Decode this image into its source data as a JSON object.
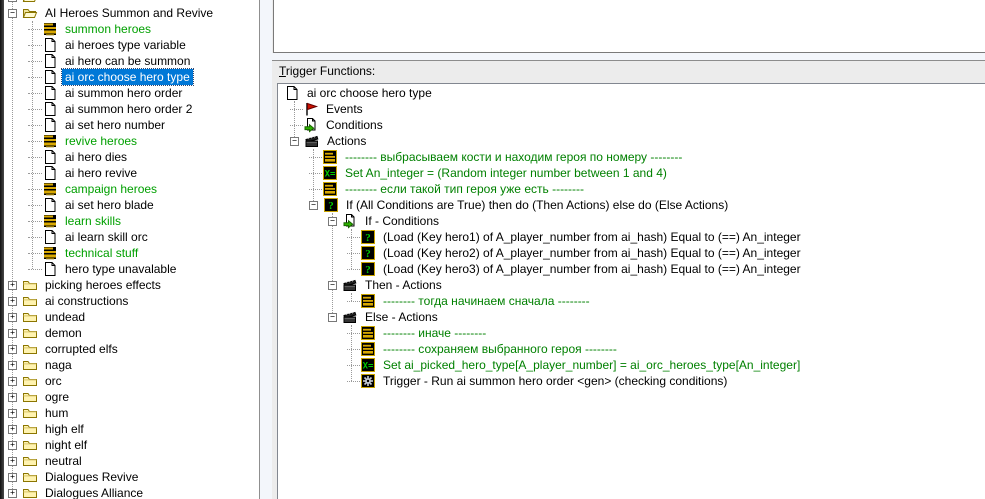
{
  "colors": {
    "selection": "#0078D7",
    "left_green": "#00A000",
    "right_green": "#008000",
    "comment_icon_gold": "#D8A800",
    "action_glyph_green": "#00CC00"
  },
  "left_tree": {
    "items": [
      {
        "label": "",
        "icon": "folder-open-icon",
        "level": 0,
        "expand": "minus",
        "partial": true
      },
      {
        "label": "AI Heroes Summon and Revive",
        "icon": "folder-open-icon",
        "level": 0,
        "expand": "minus"
      },
      {
        "label": "summon heroes",
        "icon": "comment-trigger-icon",
        "level": 1,
        "color": "green"
      },
      {
        "label": "ai heroes type variable",
        "icon": "page-icon",
        "level": 1
      },
      {
        "label": "ai hero can be summon",
        "icon": "page-icon",
        "level": 1
      },
      {
        "label": "ai orc choose hero type",
        "icon": "page-icon",
        "level": 1,
        "selected": true
      },
      {
        "label": "ai summon hero order",
        "icon": "page-icon",
        "level": 1
      },
      {
        "label": "ai summon hero order 2",
        "icon": "page-icon",
        "level": 1
      },
      {
        "label": "ai set hero number",
        "icon": "page-icon",
        "level": 1
      },
      {
        "label": "revive heroes",
        "icon": "comment-trigger-icon",
        "level": 1,
        "color": "green"
      },
      {
        "label": "ai hero dies",
        "icon": "page-icon",
        "level": 1
      },
      {
        "label": "ai hero revive",
        "icon": "page-icon",
        "level": 1
      },
      {
        "label": "campaign heroes",
        "icon": "comment-trigger-icon",
        "level": 1,
        "color": "green"
      },
      {
        "label": "ai set hero blade",
        "icon": "page-icon",
        "level": 1
      },
      {
        "label": "learn skills",
        "icon": "comment-trigger-icon",
        "level": 1,
        "color": "green"
      },
      {
        "label": "ai learn skill orc",
        "icon": "page-icon",
        "level": 1
      },
      {
        "label": "technical stuff",
        "icon": "comment-trigger-icon",
        "level": 1,
        "color": "green"
      },
      {
        "label": "hero type unavalable",
        "icon": "page-icon",
        "level": 1
      },
      {
        "label": "picking heroes effects",
        "icon": "folder-closed-icon",
        "level": 0,
        "expand": "plus"
      },
      {
        "label": "ai constructions",
        "icon": "folder-closed-icon",
        "level": 0,
        "expand": "plus"
      },
      {
        "label": "undead",
        "icon": "folder-closed-icon",
        "level": 0,
        "expand": "plus"
      },
      {
        "label": "demon",
        "icon": "folder-closed-icon",
        "level": 0,
        "expand": "plus"
      },
      {
        "label": "corrupted elfs",
        "icon": "folder-closed-icon",
        "level": 0,
        "expand": "plus"
      },
      {
        "label": "naga",
        "icon": "folder-closed-icon",
        "level": 0,
        "expand": "plus"
      },
      {
        "label": "orc",
        "icon": "folder-closed-icon",
        "level": 0,
        "expand": "plus"
      },
      {
        "label": "ogre",
        "icon": "folder-closed-icon",
        "level": 0,
        "expand": "plus"
      },
      {
        "label": "hum",
        "icon": "folder-closed-icon",
        "level": 0,
        "expand": "plus"
      },
      {
        "label": "high elf",
        "icon": "folder-closed-icon",
        "level": 0,
        "expand": "plus"
      },
      {
        "label": "night elf",
        "icon": "folder-closed-icon",
        "level": 0,
        "expand": "plus"
      },
      {
        "label": "neutral",
        "icon": "folder-closed-icon",
        "level": 0,
        "expand": "plus"
      },
      {
        "label": "Dialogues Revive",
        "icon": "folder-closed-icon",
        "level": 0,
        "expand": "plus"
      },
      {
        "label": "Dialogues Alliance",
        "icon": "folder-closed-icon",
        "level": 0,
        "expand": "plus"
      }
    ]
  },
  "right_panel": {
    "comment_value": "",
    "functions_label": "Trigger Functions:",
    "tree": [
      {
        "label": "ai orc choose hero type",
        "icon": "page-icon",
        "level": 0
      },
      {
        "label": "Events",
        "icon": "events-icon",
        "level": 1
      },
      {
        "label": "Conditions",
        "icon": "conditions-icon",
        "level": 1
      },
      {
        "label": "Actions",
        "icon": "actions-icon",
        "level": 1,
        "expand": "minus"
      },
      {
        "label": "-------- выбрасываем кости и находим героя по номеру --------",
        "icon": "comment-action-icon",
        "level": 2,
        "color": "green"
      },
      {
        "label": "Set An_integer = (Random integer number between 1 and 4)",
        "icon": "set-variable-icon",
        "level": 2,
        "color": "green"
      },
      {
        "label": "-------- если такой тип героя уже есть --------",
        "icon": "comment-action-icon",
        "level": 2,
        "color": "green"
      },
      {
        "label": "If (All Conditions are True) then do (Then Actions) else do (Else Actions)",
        "icon": "if-icon",
        "level": 2,
        "expand": "minus"
      },
      {
        "label": "If - Conditions",
        "icon": "conditions-icon",
        "level": 3,
        "expand": "minus"
      },
      {
        "label": "(Load (Key hero1) of A_player_number from ai_hash) Equal to (==) An_integer",
        "icon": "condition-icon",
        "level": 4
      },
      {
        "label": "(Load (Key hero2) of A_player_number from ai_hash) Equal to (==) An_integer",
        "icon": "condition-icon",
        "level": 4
      },
      {
        "label": "(Load (Key hero3) of A_player_number from ai_hash) Equal to (==) An_integer",
        "icon": "condition-icon",
        "level": 4
      },
      {
        "label": "Then - Actions",
        "icon": "actions-icon",
        "level": 3,
        "expand": "minus"
      },
      {
        "label": "-------- тогда начинаем сначала --------",
        "icon": "comment-action-icon",
        "level": 4,
        "color": "green"
      },
      {
        "label": "Else - Actions",
        "icon": "actions-icon",
        "level": 3,
        "expand": "minus"
      },
      {
        "label": "-------- иначе --------",
        "icon": "comment-action-icon",
        "level": 4,
        "color": "green"
      },
      {
        "label": "-------- сохраняем выбранного героя --------",
        "icon": "comment-action-icon",
        "level": 4,
        "color": "green"
      },
      {
        "label": "Set ai_picked_hero_type[A_player_number] = ai_orc_heroes_type[An_integer]",
        "icon": "set-variable-icon",
        "level": 4,
        "color": "green"
      },
      {
        "label": "Trigger - Run ai summon hero order <gen> (checking conditions)",
        "icon": "run-trigger-icon",
        "level": 4
      }
    ]
  }
}
